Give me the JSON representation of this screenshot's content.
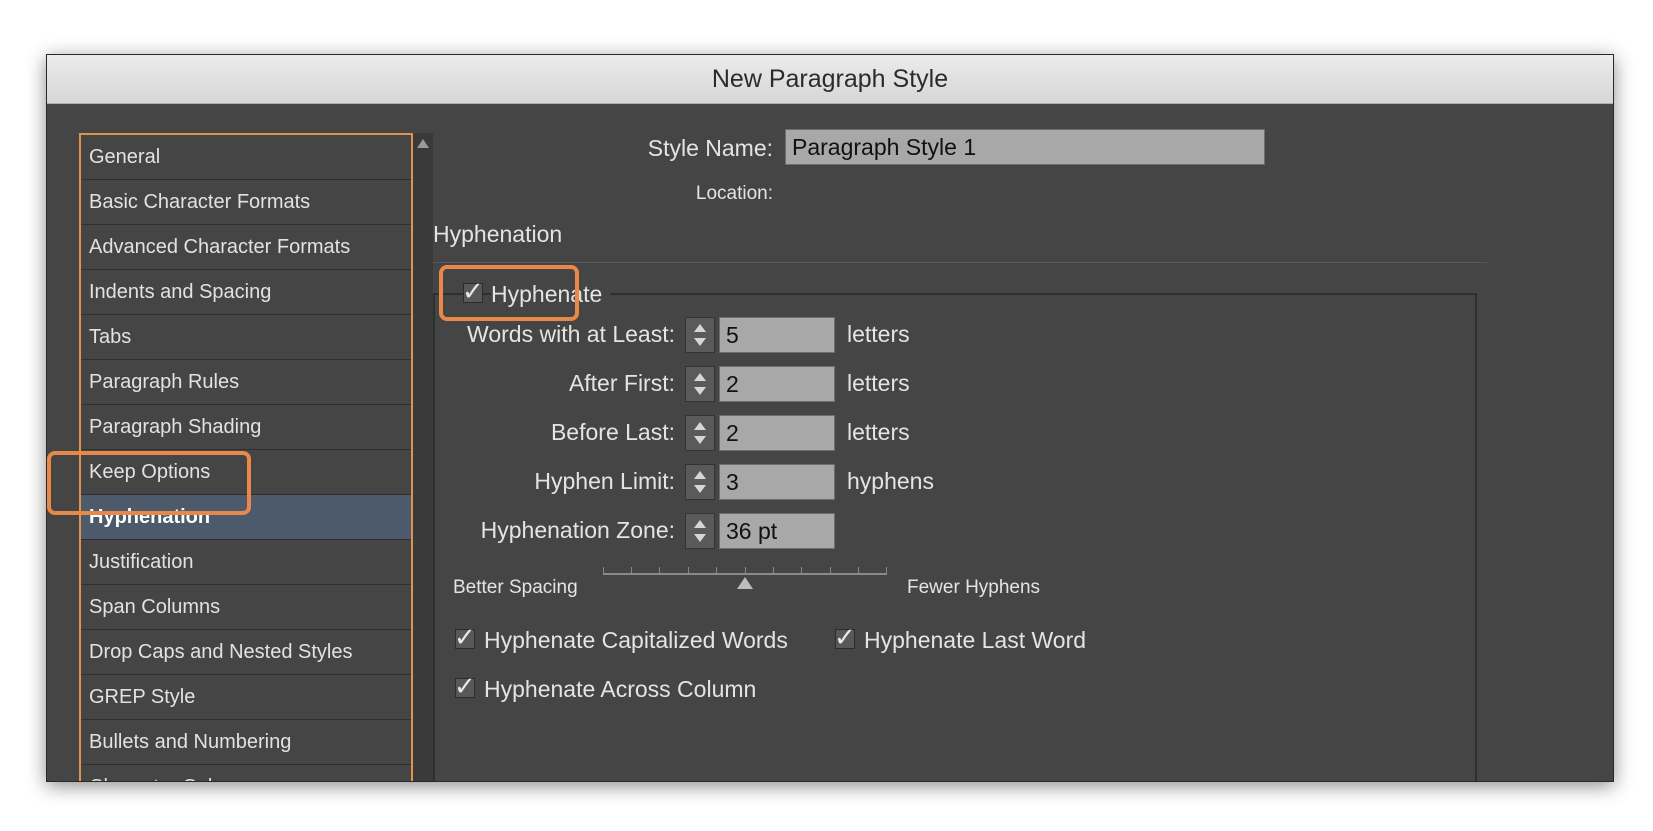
{
  "window": {
    "title": "New Paragraph Style"
  },
  "sidebar": {
    "items": [
      {
        "label": "General"
      },
      {
        "label": "Basic Character Formats"
      },
      {
        "label": "Advanced Character Formats"
      },
      {
        "label": "Indents and Spacing"
      },
      {
        "label": "Tabs"
      },
      {
        "label": "Paragraph Rules"
      },
      {
        "label": "Paragraph Shading"
      },
      {
        "label": "Keep Options"
      },
      {
        "label": "Hyphenation"
      },
      {
        "label": "Justification"
      },
      {
        "label": "Span Columns"
      },
      {
        "label": "Drop Caps and Nested Styles"
      },
      {
        "label": "GREP Style"
      },
      {
        "label": "Bullets and Numbering"
      },
      {
        "label": "Character Color"
      }
    ],
    "selected": "Hyphenation"
  },
  "main": {
    "style_name_label": "Style Name:",
    "style_name_value": "Paragraph Style 1",
    "location_label": "Location:",
    "section_title": "Hyphenation",
    "hyphenate": {
      "label": "Hyphenate",
      "checked": true
    },
    "rows": [
      {
        "label": "Words with at Least:",
        "value": "5",
        "unit": "letters"
      },
      {
        "label": "After First:",
        "value": "2",
        "unit": "letters"
      },
      {
        "label": "Before Last:",
        "value": "2",
        "unit": "letters"
      },
      {
        "label": "Hyphen Limit:",
        "value": "3",
        "unit": "hyphens"
      },
      {
        "label": "Hyphenation Zone:",
        "value": "36 pt",
        "unit": ""
      }
    ],
    "slider": {
      "left_label": "Better Spacing",
      "right_label": "Fewer Hyphens",
      "position": 0.5
    },
    "checkboxes": {
      "capitalized": {
        "label": "Hyphenate Capitalized Words",
        "checked": true
      },
      "last_word": {
        "label": "Hyphenate Last Word",
        "checked": true
      },
      "across_column": {
        "label": "Hyphenate Across Column",
        "checked": true
      }
    }
  },
  "colors": {
    "highlight": "#e8894a",
    "panel": "#454545",
    "selected": "#4c5a6b"
  }
}
